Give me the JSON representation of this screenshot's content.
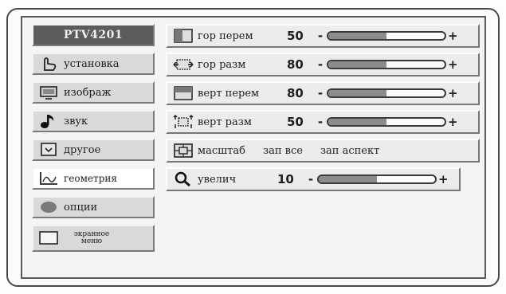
{
  "window": {
    "title": "PTV4201"
  },
  "sidebar": {
    "items": [
      {
        "label": "установка",
        "icon": "hand-pointer-icon"
      },
      {
        "label": "изображ",
        "icon": "monitor-picture-icon"
      },
      {
        "label": "звук",
        "icon": "music-note-icon"
      },
      {
        "label": "другое",
        "icon": "other-settings-icon"
      },
      {
        "label": "геометрия",
        "icon": "geometry-icon",
        "active": true
      },
      {
        "label": "опции",
        "icon": "options-oval-icon"
      },
      {
        "label": "экранное меню",
        "icon": "screen-menu-icon"
      }
    ]
  },
  "settings": {
    "h_position": {
      "label": "гор перем",
      "value": "50",
      "level": 0.5,
      "icon": "horizontal-position-icon"
    },
    "h_size": {
      "label": "гор разм",
      "value": "80",
      "level": 0.5,
      "icon": "horizontal-size-icon"
    },
    "v_position": {
      "label": "верт перем",
      "value": "80",
      "level": 0.5,
      "icon": "vertical-position-icon"
    },
    "v_size": {
      "label": "верт разм",
      "value": "50",
      "level": 0.5,
      "icon": "vertical-size-icon"
    },
    "scale": {
      "label": "масштаб",
      "option1": "зап все",
      "option2": "зап аспект",
      "icon": "scale-icon"
    },
    "zoom": {
      "label": "увелич",
      "value": "10",
      "level": 0.5,
      "icon": "magnifier-icon"
    },
    "minus_symbol": "-",
    "plus_symbol": "+"
  },
  "colors": {
    "title_bg": "#5c5c5c",
    "slider_fill": "#8c8c8c",
    "active_bg": "#ffffff"
  }
}
